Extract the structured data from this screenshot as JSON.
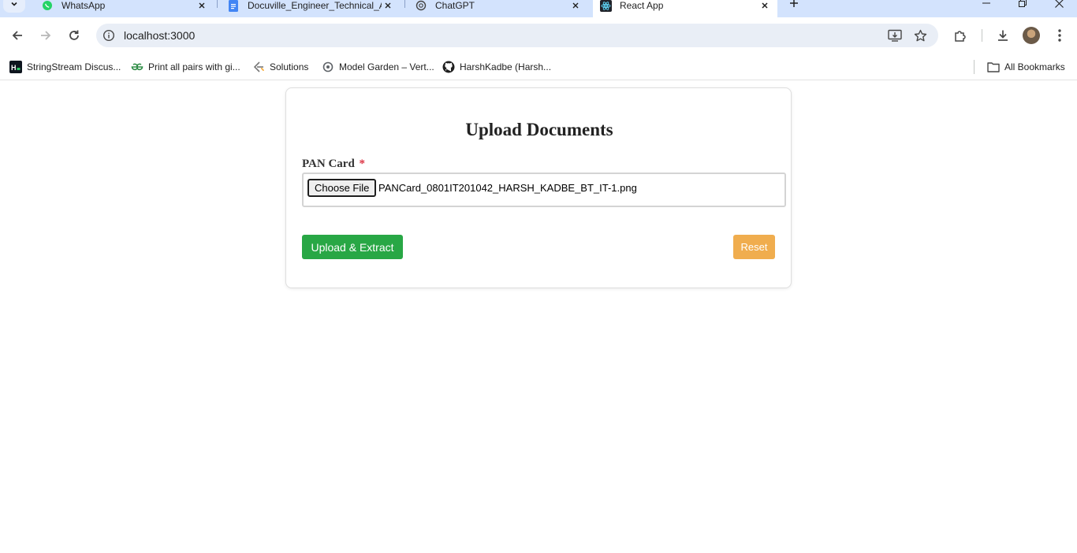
{
  "browser": {
    "tabs": [
      {
        "title": "WhatsApp",
        "icon": "whatsapp-icon",
        "active": false
      },
      {
        "title": "Docuville_Engineer_Technical_A",
        "icon": "google-docs-icon",
        "active": false
      },
      {
        "title": "ChatGPT",
        "icon": "chatgpt-icon",
        "active": false
      },
      {
        "title": "React App",
        "icon": "react-icon",
        "active": true
      }
    ],
    "url": "localhost:3000",
    "bookmarks": [
      {
        "label": "StringStream Discus...",
        "icon": "hackerrank-icon"
      },
      {
        "label": "Print all pairs with gi...",
        "icon": "geeksforgeeks-icon"
      },
      {
        "label": "Solutions",
        "icon": "leetcode-icon"
      },
      {
        "label": "Model Garden – Vert...",
        "icon": "vertex-ai-icon"
      },
      {
        "label": "HarshKadbe (Harsh...",
        "icon": "github-icon"
      }
    ],
    "all_bookmarks": "All Bookmarks"
  },
  "page": {
    "title": "Upload Documents",
    "field_label": "PAN Card",
    "required_marker": "*",
    "choose_file_label": "Choose File",
    "file_name": "PANCard_0801IT201042_HARSH_KADBE_BT_IT-1.png",
    "upload_button": "Upload & Extract",
    "reset_button": "Reset"
  },
  "colors": {
    "upload": "#28a745",
    "reset": "#f0ad4e",
    "required": "#dc3545",
    "tabstrip": "#d3e3fd"
  }
}
